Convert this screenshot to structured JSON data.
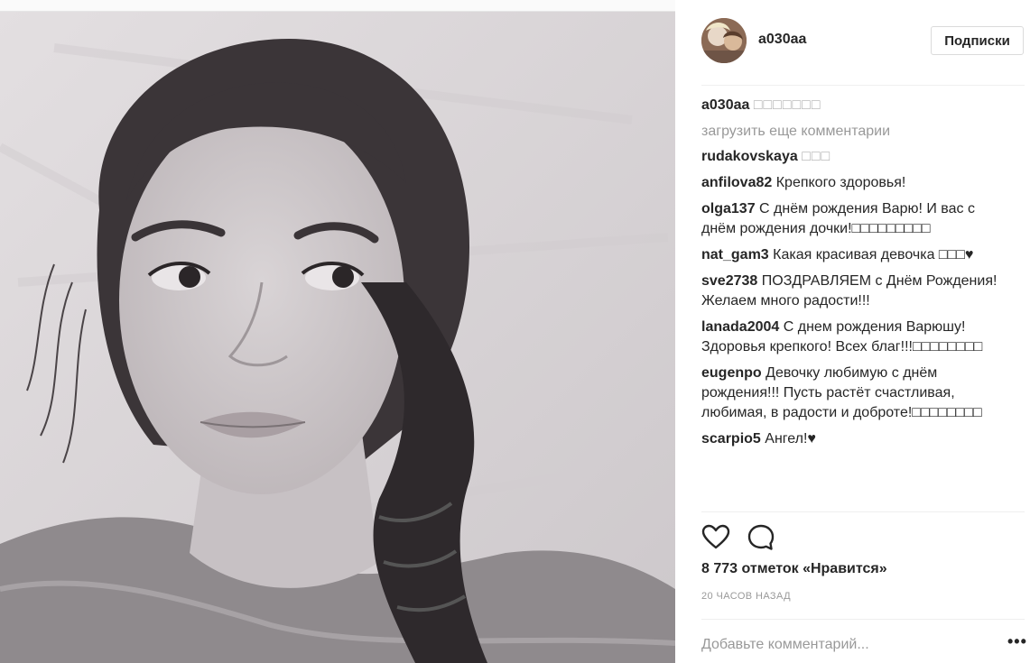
{
  "post": {
    "author": "a030aa",
    "follow_label": "Подписки",
    "caption": {
      "username": "a030aa",
      "text": "□□□□□□□"
    },
    "load_more": "загрузить еще комментарии",
    "comments": [
      {
        "username": "rudakovskaya",
        "text": "□□□"
      },
      {
        "username": "anfilova82",
        "text": "Крепкого здоровья!"
      },
      {
        "username": "olga137",
        "text": "С днём рождения Варю! И вас с днём рождения дочки!□□□□□□□□□"
      },
      {
        "username": "nat_gam3",
        "text": "Какая красивая девочка □□□♥"
      },
      {
        "username": "sve2738",
        "text": "ПОЗДРАВЛЯЕМ с Днём Рождения! Желаем много радости!!!"
      },
      {
        "username": "lanada2004",
        "text": "С днем рождения Варюшу! Здоровья крепкого! Всех благ!!!□□□□□□□□"
      },
      {
        "username": "eugenpo",
        "text": "Девочку любимую с днём рождения!!! Пусть растёт счастливая, любимая, в радости и доброте!□□□□□□□□"
      },
      {
        "username": "scarpio5",
        "text": "Ангел!♥"
      }
    ],
    "likes": "8 773 отметок «Нравится»",
    "timestamp": "20 часов назад",
    "comment_placeholder": "Добавьте комментарий...",
    "more_label": "•••",
    "icons": {
      "like": "heart-icon",
      "comment": "speech-bubble-icon",
      "options": "more-options-icon"
    }
  }
}
